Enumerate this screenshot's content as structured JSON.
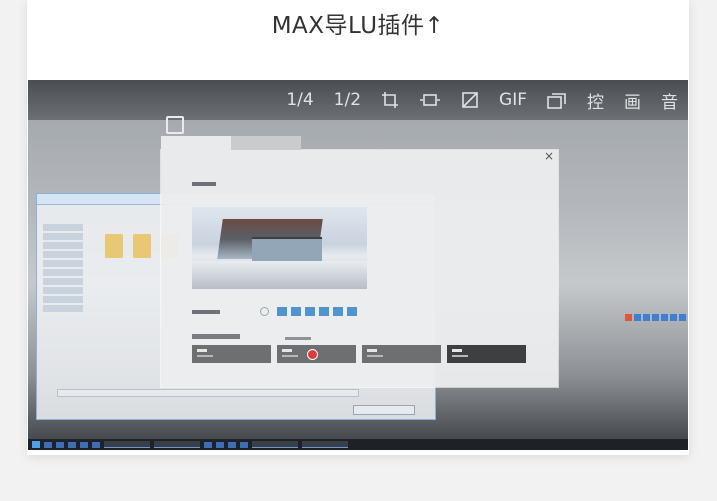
{
  "article": {
    "caption": "MAX导LU插件↑"
  },
  "video_toolbar": {
    "items": [
      {
        "label": "1/4",
        "name": "quarter-size-button"
      },
      {
        "label": "1/2",
        "name": "half-size-button"
      },
      {
        "icon": "crop-frame-icon"
      },
      {
        "icon": "resize-icon"
      },
      {
        "icon": "crop-icon"
      },
      {
        "label": "GIF",
        "name": "gif-button"
      },
      {
        "icon": "copy-window-icon"
      },
      {
        "label": "控",
        "name": "control-button"
      },
      {
        "label": "画",
        "name": "draw-button"
      },
      {
        "label": "音",
        "name": "audio-button"
      }
    ]
  },
  "dialog": {
    "close_label": "×"
  },
  "colors": {
    "accent": "#4f94cf",
    "dark_button": "#3d3f42",
    "mode_button": "#6d6f72",
    "cursor_highlight": "#e23a3a"
  }
}
